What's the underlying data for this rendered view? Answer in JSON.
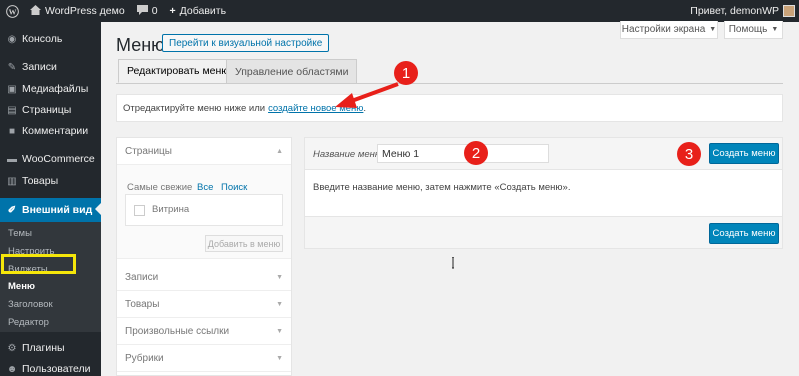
{
  "adminbar": {
    "site_name": "WordPress демо",
    "comments_count": "0",
    "add_label": "Добавить",
    "greeting": "Привет, demonWP"
  },
  "sidebar": {
    "items": [
      {
        "label": "Консоль",
        "icon": "dashboard-icon"
      },
      {
        "label": "Записи",
        "icon": "pin-icon"
      },
      {
        "label": "Медиафайлы",
        "icon": "media-icon"
      },
      {
        "label": "Страницы",
        "icon": "page-icon"
      },
      {
        "label": "Комментарии",
        "icon": "comment-icon"
      },
      {
        "label": "WooCommerce",
        "icon": "woocommerce-icon"
      },
      {
        "label": "Товары",
        "icon": "archive-icon"
      },
      {
        "label": "Внешний вид",
        "icon": "brush-icon"
      },
      {
        "label": "Плагины",
        "icon": "plugin-icon"
      },
      {
        "label": "Пользователи",
        "icon": "users-icon"
      }
    ],
    "submenu": [
      "Темы",
      "Настроить",
      "Виджеты",
      "Меню",
      "Заголовок",
      "Редактор"
    ],
    "highlight_color": "#f5e60a",
    "active_color": "#0073aa"
  },
  "screen_options": {
    "screen_label": "Настройки экрана",
    "help_label": "Помощь"
  },
  "page": {
    "title": "Меню",
    "title_action": "Перейти к визуальной настройке"
  },
  "tabs": [
    {
      "label": "Редактировать меню"
    },
    {
      "label": "Управление областями"
    }
  ],
  "notice": {
    "text": "Отредактируйте меню ниже или",
    "link": "создайте новое меню",
    "suffix": "."
  },
  "accordion": {
    "sections": [
      "Страницы",
      "Записи",
      "Товары",
      "Произвольные ссылки",
      "Рубрики"
    ],
    "inner_tabs": [
      "Самые свежие",
      "Все",
      "Поиск"
    ],
    "item_label": "Витрина",
    "add_button": "Добавить в меню"
  },
  "editor": {
    "name_label": "Название меню",
    "name_value": "Меню 1",
    "create_button": "Создать меню",
    "instruction": "Введите название меню, затем нажмите «Создать меню»."
  },
  "annotations": {
    "markers": [
      "1",
      "2",
      "3"
    ],
    "color": "#e8201a"
  }
}
